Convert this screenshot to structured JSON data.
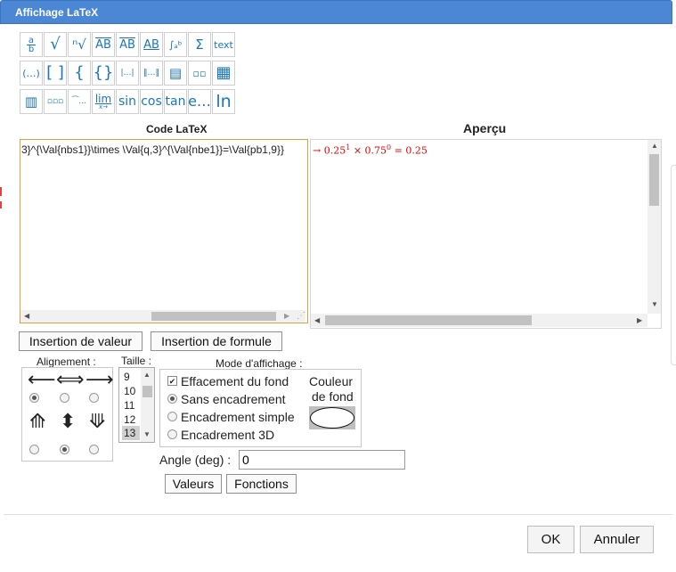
{
  "dialog": {
    "title": "Affichage LaTeX"
  },
  "toolbar": {
    "row1": [
      "a/b",
      "√",
      "ⁿ√",
      "AB→",
      "AB⃡",
      "AB",
      "∫ₐᵇ",
      "Σ",
      "text"
    ],
    "row2": [
      "(…)",
      "[ ]",
      "{",
      "{}",
      "|…|",
      "‖…‖",
      "▤",
      "▫▫",
      "▦"
    ],
    "row3": [
      "▥",
      "▫▫▫",
      "⁀…",
      "lim",
      "sin",
      "cos",
      "tan",
      "e…",
      "ln"
    ],
    "lim_sub": "x→"
  },
  "editor": {
    "label": "Code LaTeX",
    "code": "3}^{\\Val{nbs1}}\\times \\Val{q,3}^{\\Val{nbe1}}=\\Val{pb1,9}}"
  },
  "preview": {
    "label": "Aperçu",
    "arrow": "→",
    "base1": "0.25",
    "exp1": "1",
    "times": "×",
    "base2": "0.75",
    "exp2": "0",
    "eq": "=",
    "result": "0.25"
  },
  "buttons": {
    "insert_value": "Insertion de valeur",
    "insert_formula": "Insertion de formule",
    "values": "Valeurs",
    "functions": "Fonctions",
    "ok": "OK",
    "cancel": "Annuler"
  },
  "alignment": {
    "label": "Alignement :",
    "horizontal": [
      "⟵",
      "⟺",
      "⟶"
    ],
    "vertical": [
      "⟰",
      "⬍",
      "⟱"
    ],
    "selected_top_row": 0,
    "selected_bottom_row": 1
  },
  "size": {
    "label": "Taille :",
    "options": [
      "9",
      "10",
      "11",
      "12",
      "13"
    ],
    "selected": "13"
  },
  "display_mode": {
    "label": "Mode d'affichage :",
    "clear_background": "Effacement du fond",
    "clear_background_checked": true,
    "options": [
      "Sans encadrement",
      "Encadrement simple",
      "Encadrement 3D"
    ],
    "selected": "Sans encadrement",
    "background_color_label_1": "Couleur",
    "background_color_label_2": "de fond"
  },
  "angle": {
    "label": "Angle (deg) :",
    "value": "0"
  },
  "colors": {
    "title_bar": "#4b87d4",
    "preview_red": "#e00000",
    "toolbar_icon": "#1b76bb"
  }
}
